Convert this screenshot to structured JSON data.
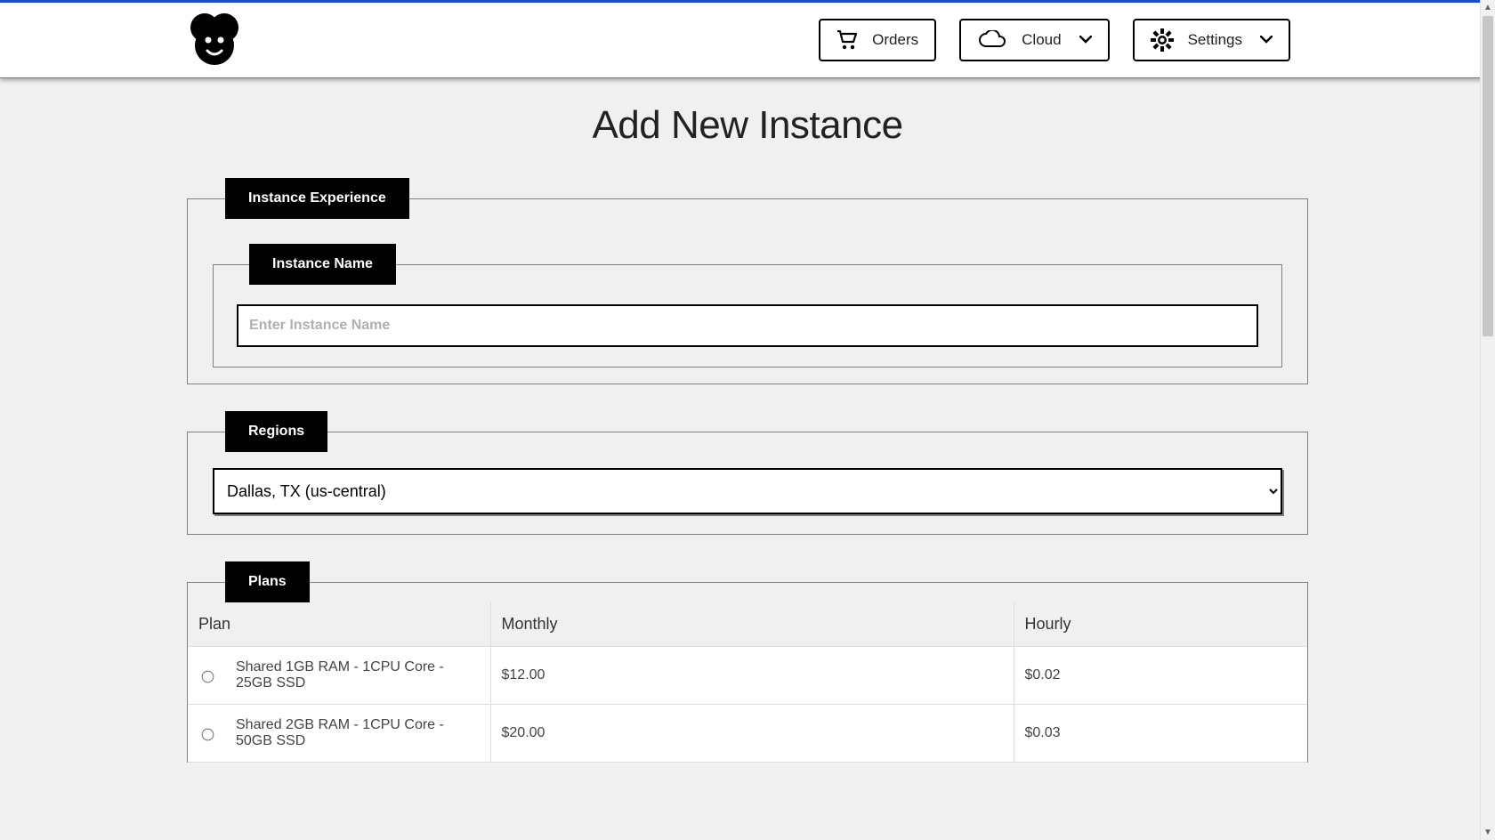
{
  "header": {
    "orders_label": "Orders",
    "cloud_label": "Cloud",
    "settings_label": "Settings"
  },
  "page": {
    "title": "Add New Instance"
  },
  "experience": {
    "legend": "Instance Experience",
    "instance_name_legend": "Instance Name",
    "instance_name_placeholder": "Enter Instance Name",
    "instance_name_value": ""
  },
  "regions": {
    "legend": "Regions",
    "selected": "Dallas, TX (us-central)"
  },
  "plans": {
    "legend": "Plans",
    "columns": {
      "plan": "Plan",
      "monthly": "Monthly",
      "hourly": "Hourly"
    },
    "rows": [
      {
        "plan": "Shared 1GB RAM - 1CPU Core - 25GB SSD",
        "monthly": "$12.00",
        "hourly": "$0.02"
      },
      {
        "plan": "Shared 2GB RAM - 1CPU Core - 50GB SSD",
        "monthly": "$20.00",
        "hourly": "$0.03"
      }
    ]
  }
}
